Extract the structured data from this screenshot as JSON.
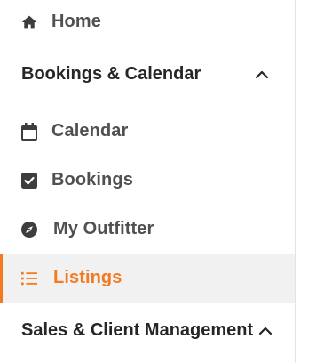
{
  "sidebar": {
    "home": {
      "label": "Home",
      "icon": "home-icon"
    },
    "bookings_section": {
      "label": "Bookings & Calendar",
      "expanded": true
    },
    "items": [
      {
        "label": "Calendar",
        "icon": "calendar-icon"
      },
      {
        "label": "Bookings",
        "icon": "checkbox-icon"
      },
      {
        "label": "My Outfitter",
        "icon": "compass-icon"
      },
      {
        "label": "Listings",
        "icon": "list-icon",
        "active": true
      }
    ],
    "sales_section": {
      "label": "Sales & Client Management",
      "expanded": true
    }
  },
  "colors": {
    "accent": "#f47a20",
    "active_background": "#f1f1f1",
    "text": "#505050"
  }
}
